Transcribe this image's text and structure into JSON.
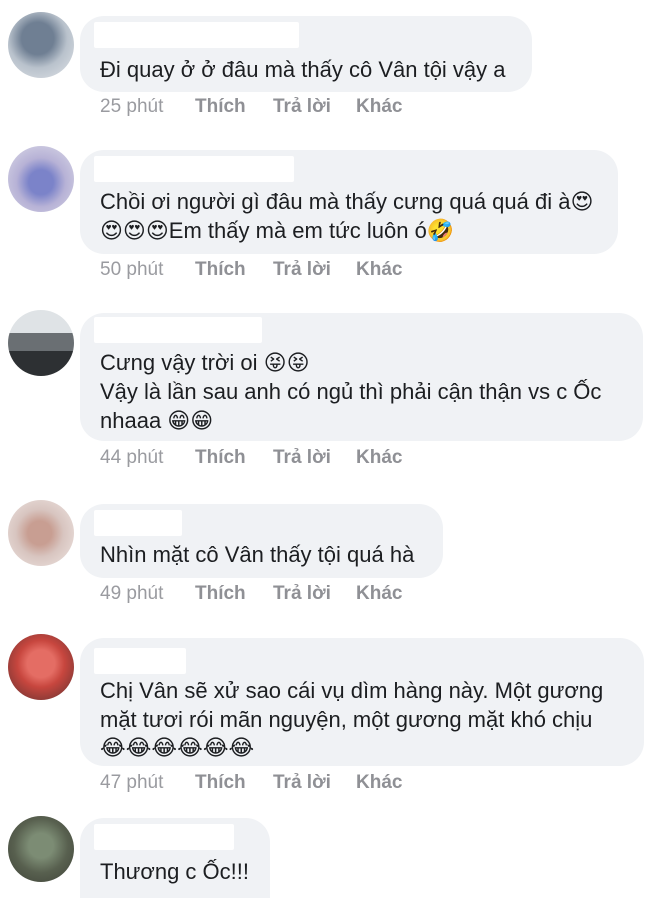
{
  "actions": {
    "like": "Thích",
    "reply": "Trả lời",
    "more": "Khác"
  },
  "comments": [
    {
      "text_lines": [
        "Đi quay ở ở đâu mà thấy cô Vân tội vậy a"
      ],
      "time": "25 phút"
    },
    {
      "text_lines": [
        "Chồi ơi người gì đâu mà thấy cưng quá quá đi à😍",
        "😍😍😍Em thấy mà em tức luôn ó🤣"
      ],
      "time": "50 phút"
    },
    {
      "text_lines": [
        "Cưng vậy trời oi 😝😝",
        "Vậy là lần sau anh có ngủ thì phải cận thận vs c Ốc",
        "nhaaa 😁😁"
      ],
      "time": "44 phút"
    },
    {
      "text_lines": [
        "Nhìn mặt cô Vân thấy tội quá hà"
      ],
      "time": "49 phút"
    },
    {
      "text_lines": [
        "Chị Vân sẽ xử sao cái vụ dìm hàng này. Một gương",
        "mặt tươi rói mãn nguyện, một gương mặt khó chịu",
        "😂😂😂😂😂😂"
      ],
      "time": "47 phút"
    },
    {
      "text_lines": [
        "Thương c Ốc!!!"
      ],
      "time": ""
    }
  ]
}
